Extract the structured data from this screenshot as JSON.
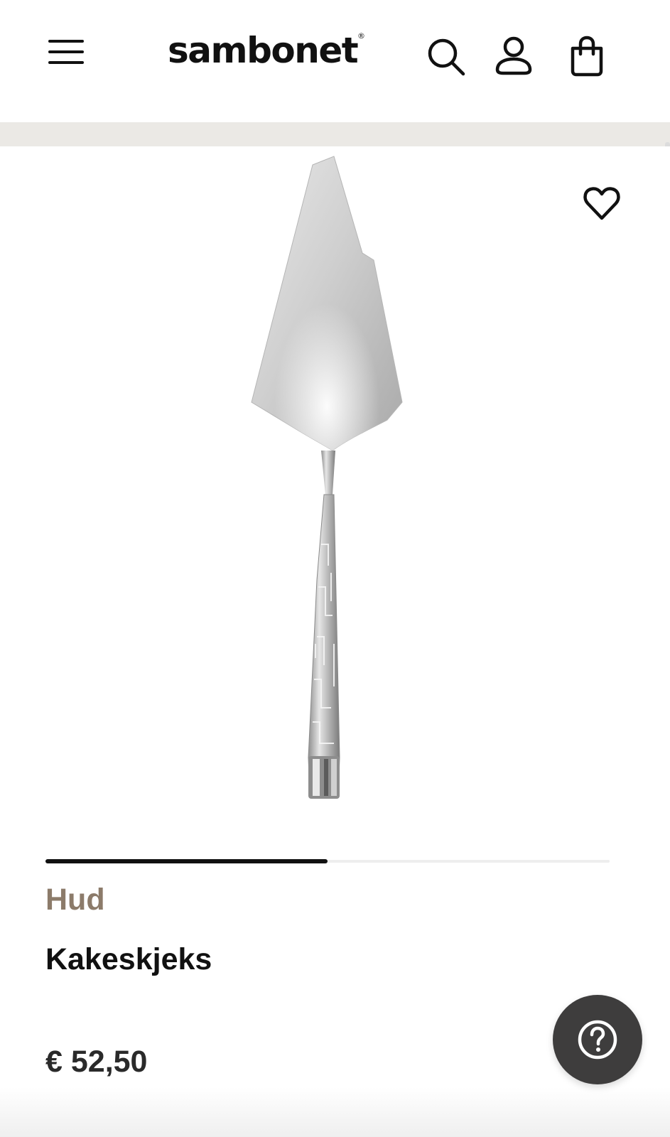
{
  "header": {
    "logo_text": "sambonet",
    "logo_mark": "®",
    "icons": {
      "menu": "hamburger-menu-icon",
      "search": "search-icon",
      "account": "user-icon",
      "cart": "shopping-bag-icon"
    }
  },
  "product": {
    "image_description_icon": "cake-server-image",
    "wishlist_icon": "heart-icon",
    "collection": "Hud",
    "name": "Kakeskjeks",
    "price": "€ 52,50",
    "gallery_progress": 0.5
  },
  "help": {
    "icon": "question-mark-icon"
  },
  "colors": {
    "collection_text": "#8c7b6a",
    "band": "#ebe9e5",
    "help_button": "#3e3d3d"
  }
}
